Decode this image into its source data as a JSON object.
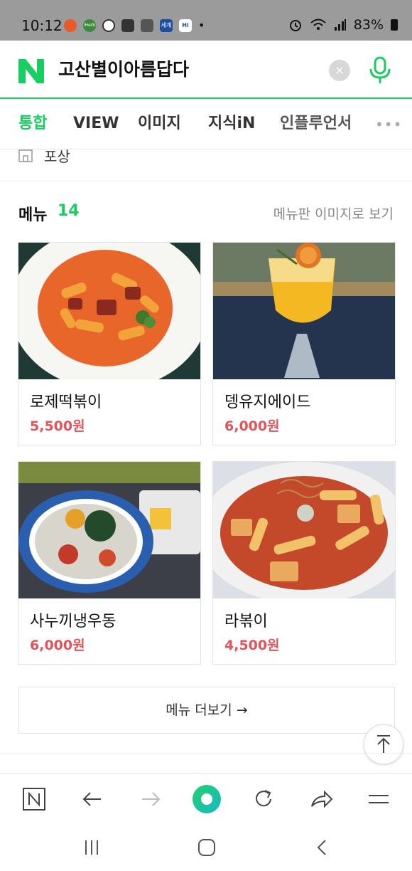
{
  "status_bar": {
    "time": "10:12",
    "battery": "83%",
    "notification_icons": [
      "red-app-icon",
      "iherb-icon",
      "circle-app-icon",
      "gmail-icon",
      "flag-icon",
      "news-icon",
      "hi-icon"
    ],
    "notification_labels": [
      "",
      "iHerb",
      "",
      "",
      "",
      "세계",
      "Hi"
    ]
  },
  "search": {
    "query": "고산별이아름답다",
    "clear_label": "×"
  },
  "tabs": [
    {
      "label": "통합",
      "active": true
    },
    {
      "label": "VIEW",
      "active": false
    },
    {
      "label": "이미지",
      "active": false
    },
    {
      "label": "지식iN",
      "active": false
    },
    {
      "label": "인플루언서",
      "active": false
    }
  ],
  "more_tabs_label": "•••",
  "address_row": {
    "text": "포상"
  },
  "menu": {
    "title": "메뉴",
    "count": "14",
    "view_image_link": "메뉴판 이미지로 보기",
    "items": [
      {
        "name": "로제떡볶이",
        "price": "5,500원"
      },
      {
        "name": "뎅유지에이드",
        "price": "6,000원"
      },
      {
        "name": "사누끼냉우동",
        "price": "6,000원"
      },
      {
        "name": "라볶이",
        "price": "4,500원"
      }
    ],
    "more_button": "메뉴 더보기 →"
  },
  "colors": {
    "naver_green": "#19ce60",
    "price_red": "#e0545a",
    "status_bar_gray": "#9b9b9b"
  }
}
